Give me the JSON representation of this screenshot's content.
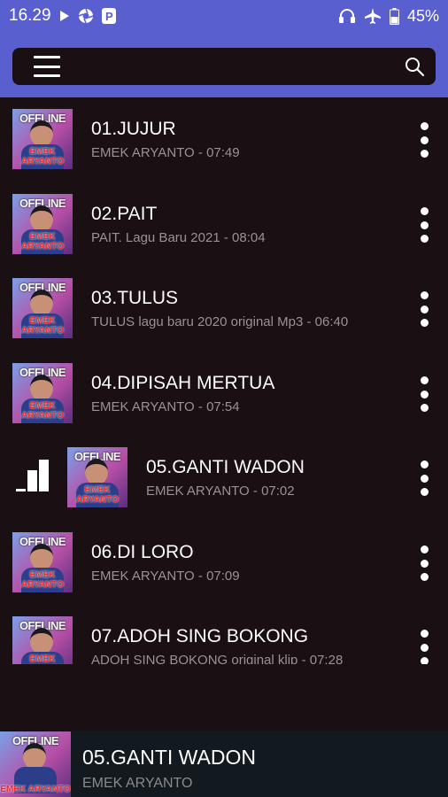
{
  "statusbar": {
    "time": "16.29",
    "battery": "45%",
    "icons": [
      "play-icon",
      "aperture-icon",
      "p-icon",
      "headphones-icon",
      "airplane-icon",
      "battery-icon"
    ]
  },
  "toolbar": {
    "icons": [
      "hamburger-menu-icon",
      "search-icon"
    ]
  },
  "thumb": {
    "top_text": "OFFLINE",
    "bottom_text": "EMEK ARYANTO"
  },
  "songs": [
    {
      "title": "01.JUJUR",
      "artist": "EMEK ARYANTO",
      "duration": "07:49"
    },
    {
      "title": "02.PAIT",
      "artist": "PAIT. Lagu Baru 2021",
      "duration": "08:04"
    },
    {
      "title": "03.TULUS",
      "artist": "TULUS lagu baru 2020 original Mp3",
      "duration": "06:40"
    },
    {
      "title": "04.DIPISAH MERTUA",
      "artist": "EMEK ARYANTO",
      "duration": "07:54"
    },
    {
      "title": "05.GANTI WADON",
      "artist": "EMEK ARYANTO",
      "duration": "07:02",
      "playing": true
    },
    {
      "title": "06.DI LORO",
      "artist": "EMEK ARYANTO",
      "duration": "07:09"
    },
    {
      "title": "07.ADOH SING BOKONG",
      "artist": "ADOH SING BOKONG original klip",
      "duration": "07:28"
    }
  ],
  "now_playing": {
    "title": "05.GANTI WADON",
    "artist": "EMEK ARYANTO"
  },
  "colors": {
    "header": "#5a5fd0",
    "background": "#1a0f12",
    "subtext": "#9a9296",
    "miniplayer": "#131a1f"
  }
}
